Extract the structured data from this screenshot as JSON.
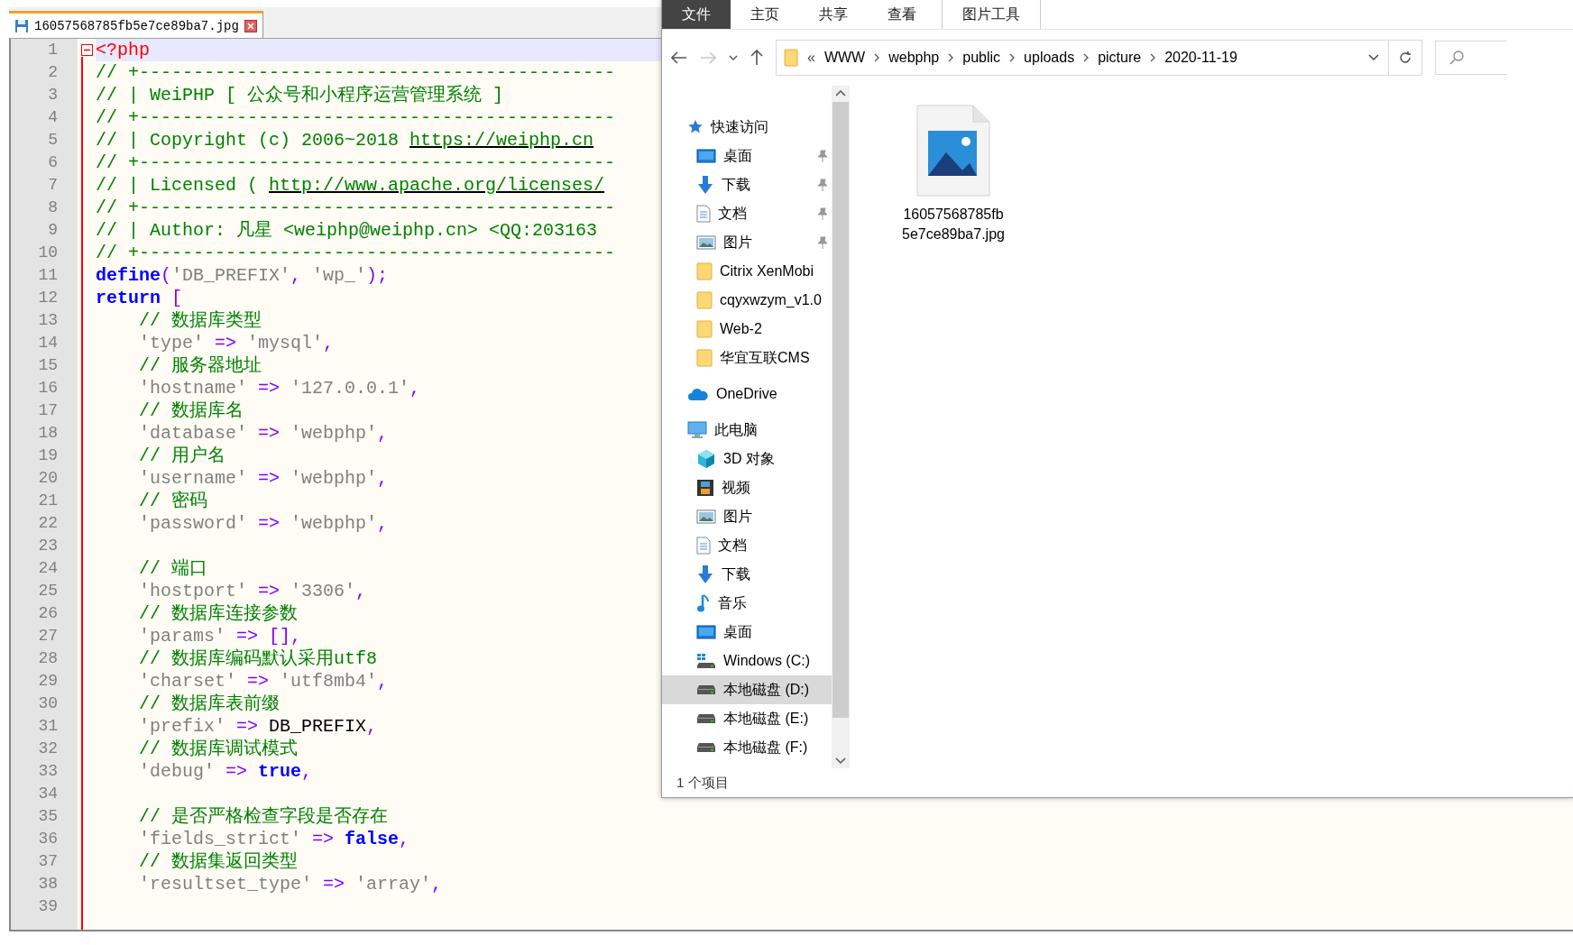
{
  "editor": {
    "tab": {
      "filename": "16057568785fb5e7ce89ba7.jpg",
      "selected": true
    },
    "lines": [
      {
        "number": "1",
        "current": true,
        "fold": true,
        "tokens": [
          {
            "kind": "tag",
            "text": "<?php"
          }
        ]
      },
      {
        "number": "2",
        "current": false,
        "fold": false,
        "tokens": [
          {
            "kind": "comment",
            "text": "// +--------------------------------------------"
          }
        ]
      },
      {
        "number": "3",
        "current": false,
        "fold": false,
        "tokens": [
          {
            "kind": "comment",
            "text": "// | WeiPHP [ 公众号和小程序运营管理系统 ]"
          }
        ]
      },
      {
        "number": "4",
        "current": false,
        "fold": false,
        "tokens": [
          {
            "kind": "comment",
            "text": "// +--------------------------------------------"
          }
        ]
      },
      {
        "number": "5",
        "current": false,
        "fold": false,
        "tokens": [
          {
            "kind": "comment",
            "text": "// | Copyright (c) 2006~2018 "
          },
          {
            "kind": "link",
            "text": "https://weiphp.cn"
          }
        ]
      },
      {
        "number": "6",
        "current": false,
        "fold": false,
        "tokens": [
          {
            "kind": "comment",
            "text": "// +--------------------------------------------"
          }
        ]
      },
      {
        "number": "7",
        "current": false,
        "fold": false,
        "tokens": [
          {
            "kind": "comment",
            "text": "// | Licensed ( "
          },
          {
            "kind": "link",
            "text": "http://www.apache.org/licenses/"
          }
        ]
      },
      {
        "number": "8",
        "current": false,
        "fold": false,
        "tokens": [
          {
            "kind": "comment",
            "text": "// +--------------------------------------------"
          }
        ]
      },
      {
        "number": "9",
        "current": false,
        "fold": false,
        "tokens": [
          {
            "kind": "comment",
            "text": "// | Author: 凡星 <weiphp@weiphp.cn> <QQ:203163"
          }
        ]
      },
      {
        "number": "10",
        "current": false,
        "fold": false,
        "tokens": [
          {
            "kind": "comment",
            "text": "// +--------------------------------------------"
          }
        ]
      },
      {
        "number": "11",
        "current": false,
        "fold": false,
        "tokens": [
          {
            "kind": "keyword",
            "text": "define"
          },
          {
            "kind": "operator",
            "text": "("
          },
          {
            "kind": "string",
            "text": "'DB_PREFIX'"
          },
          {
            "kind": "operator",
            "text": ", "
          },
          {
            "kind": "string",
            "text": "'wp_'"
          },
          {
            "kind": "operator",
            "text": ");"
          }
        ]
      },
      {
        "number": "12",
        "current": false,
        "fold": false,
        "tokens": [
          {
            "kind": "keyword",
            "text": "return"
          },
          {
            "kind": "operator",
            "text": " ["
          }
        ]
      },
      {
        "number": "13",
        "current": false,
        "fold": false,
        "tokens": [
          {
            "kind": "comment",
            "text": "    // 数据库类型"
          }
        ]
      },
      {
        "number": "14",
        "current": false,
        "fold": false,
        "tokens": [
          {
            "kind": "string",
            "text": "    'type'"
          },
          {
            "kind": "operator",
            "text": " => "
          },
          {
            "kind": "string",
            "text": "'mysql'"
          },
          {
            "kind": "operator",
            "text": ","
          }
        ]
      },
      {
        "number": "15",
        "current": false,
        "fold": false,
        "tokens": [
          {
            "kind": "comment",
            "text": "    // 服务器地址"
          }
        ]
      },
      {
        "number": "16",
        "current": false,
        "fold": false,
        "tokens": [
          {
            "kind": "string",
            "text": "    'hostname'"
          },
          {
            "kind": "operator",
            "text": " => "
          },
          {
            "kind": "string",
            "text": "'127.0.0.1'"
          },
          {
            "kind": "operator",
            "text": ","
          }
        ]
      },
      {
        "number": "17",
        "current": false,
        "fold": false,
        "tokens": [
          {
            "kind": "comment",
            "text": "    // 数据库名"
          }
        ]
      },
      {
        "number": "18",
        "current": false,
        "fold": false,
        "tokens": [
          {
            "kind": "string",
            "text": "    'database'"
          },
          {
            "kind": "operator",
            "text": " => "
          },
          {
            "kind": "string",
            "text": "'webphp'"
          },
          {
            "kind": "operator",
            "text": ","
          }
        ]
      },
      {
        "number": "19",
        "current": false,
        "fold": false,
        "tokens": [
          {
            "kind": "comment",
            "text": "    // 用户名"
          }
        ]
      },
      {
        "number": "20",
        "current": false,
        "fold": false,
        "tokens": [
          {
            "kind": "string",
            "text": "    'username'"
          },
          {
            "kind": "operator",
            "text": " => "
          },
          {
            "kind": "string",
            "text": "'webphp'"
          },
          {
            "kind": "operator",
            "text": ","
          }
        ]
      },
      {
        "number": "21",
        "current": false,
        "fold": false,
        "tokens": [
          {
            "kind": "comment",
            "text": "    // 密码"
          }
        ]
      },
      {
        "number": "22",
        "current": false,
        "fold": false,
        "tokens": [
          {
            "kind": "string",
            "text": "    'password'"
          },
          {
            "kind": "operator",
            "text": " => "
          },
          {
            "kind": "string",
            "text": "'webphp'"
          },
          {
            "kind": "operator",
            "text": ","
          }
        ]
      },
      {
        "number": "23",
        "current": false,
        "fold": false
      },
      {
        "number": "24",
        "current": false,
        "fold": false,
        "tokens": [
          {
            "kind": "comment",
            "text": "    // 端口"
          }
        ]
      },
      {
        "number": "25",
        "current": false,
        "fold": false,
        "tokens": [
          {
            "kind": "string",
            "text": "    'hostport'"
          },
          {
            "kind": "operator",
            "text": " => "
          },
          {
            "kind": "string",
            "text": "'3306'"
          },
          {
            "kind": "operator",
            "text": ","
          }
        ]
      },
      {
        "number": "26",
        "current": false,
        "fold": false,
        "tokens": [
          {
            "kind": "comment",
            "text": "    // 数据库连接参数"
          }
        ]
      },
      {
        "number": "27",
        "current": false,
        "fold": false,
        "tokens": [
          {
            "kind": "string",
            "text": "    'params'"
          },
          {
            "kind": "operator",
            "text": " => [],"
          }
        ]
      },
      {
        "number": "28",
        "current": false,
        "fold": false,
        "tokens": [
          {
            "kind": "comment",
            "text": "    // 数据库编码默认采用utf8"
          }
        ]
      },
      {
        "number": "29",
        "current": false,
        "fold": false,
        "tokens": [
          {
            "kind": "string",
            "text": "    'charset'"
          },
          {
            "kind": "operator",
            "text": " => "
          },
          {
            "kind": "string",
            "text": "'utf8mb4'"
          },
          {
            "kind": "operator",
            "text": ","
          }
        ]
      },
      {
        "number": "30",
        "current": false,
        "fold": false,
        "tokens": [
          {
            "kind": "comment",
            "text": "    // 数据库表前缀"
          }
        ]
      },
      {
        "number": "31",
        "current": false,
        "fold": false,
        "tokens": [
          {
            "kind": "string",
            "text": "    'prefix'"
          },
          {
            "kind": "operator",
            "text": " => "
          },
          {
            "kind": "plain",
            "text": "DB_PREFIX"
          },
          {
            "kind": "operator",
            "text": ","
          }
        ]
      },
      {
        "number": "32",
        "current": false,
        "fold": false,
        "tokens": [
          {
            "kind": "comment",
            "text": "    // 数据库调试模式"
          }
        ]
      },
      {
        "number": "33",
        "current": false,
        "fold": false,
        "tokens": [
          {
            "kind": "string",
            "text": "    'debug'"
          },
          {
            "kind": "operator",
            "text": " => "
          },
          {
            "kind": "keyword",
            "text": "true"
          },
          {
            "kind": "operator",
            "text": ","
          }
        ]
      },
      {
        "number": "34",
        "current": false,
        "fold": false
      },
      {
        "number": "35",
        "current": false,
        "fold": false,
        "tokens": [
          {
            "kind": "comment",
            "text": "    // 是否严格检查字段是否存在"
          }
        ]
      },
      {
        "number": "36",
        "current": false,
        "fold": false,
        "tokens": [
          {
            "kind": "string",
            "text": "    'fields_strict'"
          },
          {
            "kind": "operator",
            "text": " => "
          },
          {
            "kind": "keyword",
            "text": "false"
          },
          {
            "kind": "operator",
            "text": ","
          }
        ]
      },
      {
        "number": "37",
        "current": false,
        "fold": false,
        "tokens": [
          {
            "kind": "comment",
            "text": "    // 数据集返回类型"
          }
        ]
      },
      {
        "number": "38",
        "current": false,
        "fold": false,
        "tokens": [
          {
            "kind": "string",
            "text": "    'resultset_type'"
          },
          {
            "kind": "operator",
            "text": " => "
          },
          {
            "kind": "string",
            "text": "'array'"
          },
          {
            "kind": "operator",
            "text": ","
          }
        ]
      },
      {
        "number": "39",
        "current": false,
        "fold": false
      }
    ]
  },
  "explorer": {
    "ribbon_tabs": [
      {
        "label": "文件",
        "selected": true,
        "kind": "file"
      },
      {
        "label": "主页",
        "selected": false,
        "kind": "tab"
      },
      {
        "label": "共享",
        "selected": false,
        "kind": "tab"
      },
      {
        "label": "查看",
        "selected": false,
        "kind": "tab"
      },
      {
        "label": "图片工具",
        "selected": false,
        "kind": "contextual"
      }
    ],
    "nav_buttons": [
      {
        "kind": "back",
        "disabled": false
      },
      {
        "kind": "forward",
        "disabled": true
      },
      {
        "kind": "recent",
        "disabled": false
      },
      {
        "kind": "up",
        "disabled": false
      }
    ],
    "address": {
      "overflow": "«",
      "crumbs": [
        "WWW",
        "webphp",
        "public",
        "uploads",
        "picture",
        "2020-11-19"
      ]
    },
    "nav_pane": [
      {
        "label": "快速访问",
        "kind": "star",
        "selected": false,
        "pinned": false,
        "children": [
          {
            "label": "桌面",
            "kind": "desktop",
            "selected": false,
            "pinned": true
          },
          {
            "label": "下载",
            "kind": "download",
            "selected": false,
            "pinned": true
          },
          {
            "label": "文档",
            "kind": "document",
            "selected": false,
            "pinned": true
          },
          {
            "label": "图片",
            "kind": "picture",
            "selected": false,
            "pinned": true
          },
          {
            "label": "Citrix XenMobi",
            "kind": "folder",
            "selected": false,
            "pinned": false
          },
          {
            "label": "cqyxwzym_v1.0",
            "kind": "folder",
            "selected": false,
            "pinned": false
          },
          {
            "label": "Web-2",
            "kind": "folder",
            "selected": false,
            "pinned": false
          },
          {
            "label": "华宜互联CMS",
            "kind": "folder",
            "selected": false,
            "pinned": false
          }
        ]
      },
      {
        "label": "OneDrive",
        "kind": "cloud",
        "selected": false,
        "pinned": false
      },
      {
        "label": "此电脑",
        "kind": "computer",
        "selected": false,
        "pinned": false,
        "children": [
          {
            "label": "3D 对象",
            "kind": "cube",
            "selected": false,
            "pinned": false
          },
          {
            "label": "视频",
            "kind": "video",
            "selected": false,
            "pinned": false
          },
          {
            "label": "图片",
            "kind": "picture",
            "selected": false,
            "pinned": false
          },
          {
            "label": "文档",
            "kind": "document",
            "selected": false,
            "pinned": false
          },
          {
            "label": "下载",
            "kind": "download",
            "selected": false,
            "pinned": false
          },
          {
            "label": "音乐",
            "kind": "music",
            "selected": false,
            "pinned": false
          },
          {
            "label": "桌面",
            "kind": "desktop",
            "selected": false,
            "pinned": false
          },
          {
            "label": "Windows (C:)",
            "kind": "windows-drive",
            "selected": false,
            "pinned": false
          },
          {
            "label": "本地磁盘 (D:)",
            "kind": "drive",
            "selected": true,
            "pinned": false
          },
          {
            "label": "本地磁盘 (E:)",
            "kind": "drive",
            "selected": false,
            "pinned": false
          },
          {
            "label": "本地磁盘 (F:)",
            "kind": "drive",
            "selected": false,
            "pinned": false
          }
        ]
      }
    ],
    "files": [
      {
        "name_lines": [
          "16057568785fb",
          "5e7ce89ba7.jpg"
        ],
        "kind": "image"
      }
    ],
    "status_bar": {
      "count": "1 个项目"
    }
  }
}
